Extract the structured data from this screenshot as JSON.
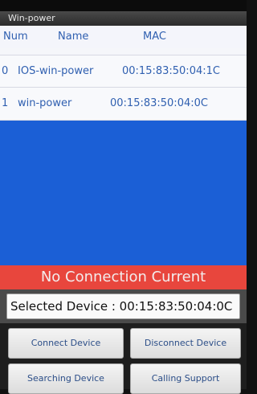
{
  "app": {
    "title": "Win-power"
  },
  "table": {
    "headers": {
      "num": "Num",
      "name": "Name",
      "mac": "MAC"
    },
    "rows": [
      {
        "num": "0",
        "name": "IOS-win-power",
        "mac": "00:15:83:50:04:1C"
      },
      {
        "num": "1",
        "name": "win-power",
        "mac": "00:15:83:50:04:0C"
      }
    ]
  },
  "status": {
    "text": "No Connection Current",
    "color": "#e8463d"
  },
  "selected": {
    "text": "Selected Device : 00:15:83:50:04:0C"
  },
  "buttons": {
    "connect": "Connect Device",
    "disconnect": "Disconnect Device",
    "search": "Searching Device",
    "support": "Calling Support"
  },
  "colors": {
    "accent": "#1b5fd6",
    "list_text": "#2f5fb0"
  }
}
